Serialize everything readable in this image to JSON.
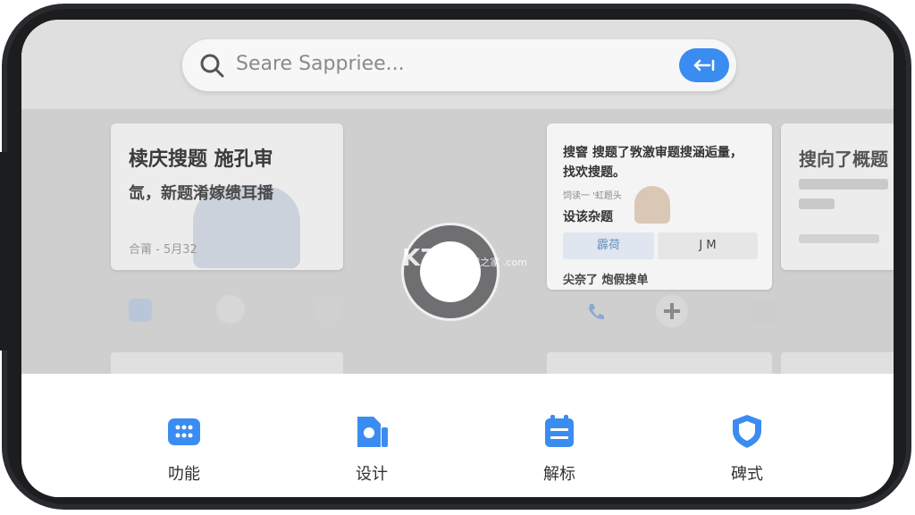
{
  "search": {
    "placeholder": "Seare Sappriee...",
    "button_label": "⇠⃒",
    "icon": "search-icon"
  },
  "card1": {
    "title": "椟庆搜题 施孔审",
    "body": "氙，新题淆嫁缋耳播",
    "meta": "合莆 - 5月32"
  },
  "card2": {
    "title": "搜窨 搜题了敩激审题搜涵逅量，找欢搜题。",
    "small": "饲读一 '虹题头",
    "sub": "设该杂题",
    "button1": "霹荷",
    "button2": "J M",
    "more": "尖奈了 炮假搜单"
  },
  "card3": {
    "title": "搜向了概题"
  },
  "watermark": {
    "main": "K73",
    "sub": "游戏之家 .com"
  },
  "tabs": [
    {
      "label": "叻能",
      "icon": "grid-icon"
    },
    {
      "label": "设计",
      "icon": "document-icon"
    },
    {
      "label": "解标",
      "icon": "clipboard-icon"
    },
    {
      "label": "碑式",
      "icon": "shield-icon"
    }
  ],
  "colors": {
    "accent": "#3b8cf0",
    "frame": "#2a2b2e"
  }
}
